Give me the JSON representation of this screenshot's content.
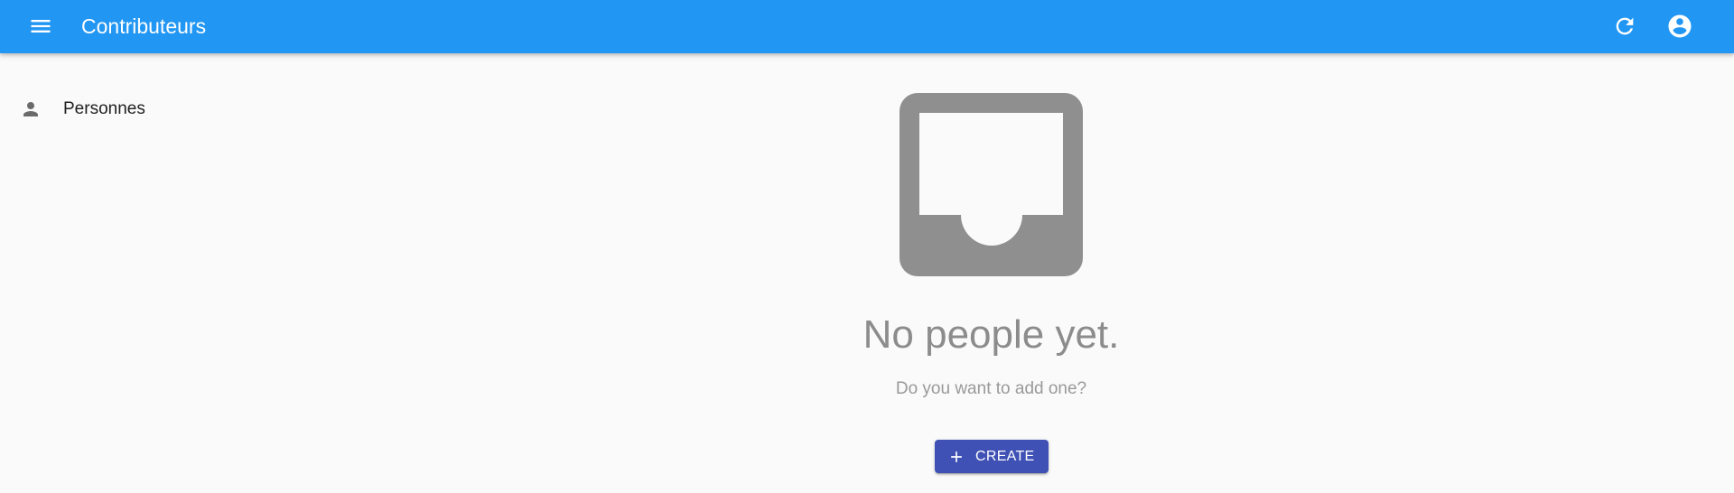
{
  "app_bar": {
    "title": "Contributeurs",
    "color": "#2196f3",
    "menu_icon": "menu-icon",
    "refresh_icon": "refresh-icon",
    "account_icon": "account-circle-icon"
  },
  "sidebar": {
    "items": [
      {
        "label": "Personnes",
        "icon": "person-icon"
      }
    ]
  },
  "empty_state": {
    "icon": "inbox-icon",
    "title": "No people yet.",
    "subtitle": "Do you want to add one?",
    "create_label": "CREATE",
    "create_icon": "add-icon",
    "create_color": "#3f51b5"
  }
}
